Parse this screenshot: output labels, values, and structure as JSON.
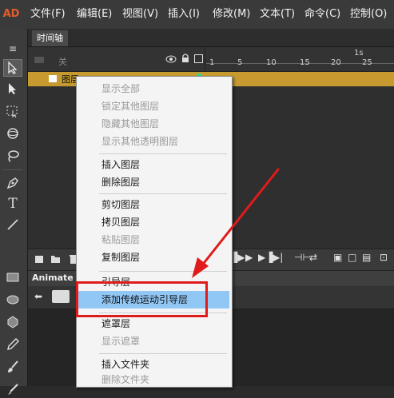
{
  "app": {
    "logo": "AD"
  },
  "menubar": {
    "items": [
      "文件(F)",
      "编辑(E)",
      "视图(V)",
      "插入(I)",
      "修改(M)",
      "文本(T)",
      "命令(C)",
      "控制(O)"
    ]
  },
  "timeline": {
    "tab_label": "时间轴",
    "header_label": "关",
    "frame_numbers": [
      "1",
      "5",
      "10",
      "15",
      "20",
      "25"
    ],
    "time_label": "1s",
    "layer_name": "图层"
  },
  "animate_panel": {
    "tab_label": "Animate"
  },
  "context_menu": {
    "items": [
      {
        "label": "显示全部",
        "disabled": true
      },
      {
        "label": "锁定其他图层",
        "disabled": true
      },
      {
        "label": "隐藏其他图层",
        "disabled": true
      },
      {
        "label": "显示其他透明图层",
        "disabled": true
      },
      {
        "label": "插入图层",
        "disabled": false
      },
      {
        "label": "删除图层",
        "disabled": false
      },
      {
        "label": "剪切图层",
        "disabled": false
      },
      {
        "label": "拷贝图层",
        "disabled": false
      },
      {
        "label": "粘贴图层",
        "disabled": true
      },
      {
        "label": "复制图层",
        "disabled": false
      },
      {
        "label": "引导层",
        "disabled": false
      },
      {
        "label": "添加传统运动引导层",
        "disabled": false,
        "highlighted": true
      },
      {
        "label": "遮罩层",
        "disabled": false
      },
      {
        "label": "显示遮罩",
        "disabled": true
      },
      {
        "label": "插入文件夹",
        "disabled": false
      },
      {
        "label": "删除文件夹",
        "disabled": true
      }
    ]
  },
  "annotation": {
    "highlight_color": "#e01b1b",
    "arrow_color": "#e01b1b"
  },
  "icons": [
    "select-arrow-icon",
    "subselect-icon",
    "free-transform-icon",
    "3d-rotate-icon",
    "lasso-icon",
    "pen-icon",
    "text-icon",
    "line-icon",
    "rectangle-icon",
    "oval-icon",
    "polystar-icon",
    "pencil-icon",
    "brush-icon",
    "eye-icon",
    "lock-icon",
    "outline-icon",
    "play-icon",
    "stop-icon",
    "loop-icon"
  ]
}
